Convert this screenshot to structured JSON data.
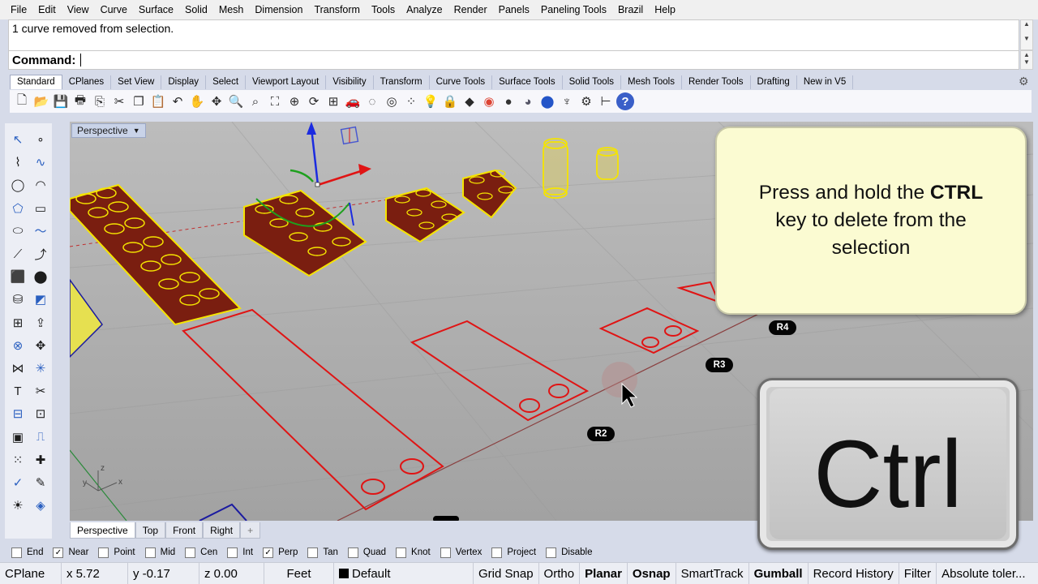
{
  "menu": [
    "File",
    "Edit",
    "View",
    "Curve",
    "Surface",
    "Solid",
    "Mesh",
    "Dimension",
    "Transform",
    "Tools",
    "Analyze",
    "Render",
    "Panels",
    "Paneling Tools",
    "Brazil",
    "Help"
  ],
  "history_text": "1 curve removed from selection.",
  "command_label": "Command:",
  "tabs": [
    "Standard",
    "CPlanes",
    "Set View",
    "Display",
    "Select",
    "Viewport Layout",
    "Visibility",
    "Transform",
    "Curve Tools",
    "Surface Tools",
    "Solid Tools",
    "Mesh Tools",
    "Render Tools",
    "Drafting",
    "New in V5"
  ],
  "toolbar_icons": [
    "new-file-icon",
    "open-file-icon",
    "save-icon",
    "print-icon",
    "import-icon",
    "cut-icon",
    "copy-icon",
    "paste-icon",
    "undo-icon",
    "pan-icon",
    "rotate-view-icon",
    "zoom-icon",
    "zoom-window-icon",
    "zoom-extents-icon",
    "zoom-selected-icon",
    "rotate-icon",
    "viewport-layout-icon",
    "car-icon",
    "hide-icon",
    "show-icon",
    "grips-icon",
    "light-bulb-icon",
    "lock-icon",
    "layer-icon",
    "color-wheel-icon",
    "render-sphere-icon",
    "render-preview-icon",
    "material-icon",
    "spotlight-icon",
    "options-icon",
    "dimension-icon",
    "help-icon"
  ],
  "left_tools": [
    "select-arrow-icon",
    "point-icon",
    "polyline-icon",
    "curve-icon",
    "circle-icon",
    "arc-icon",
    "polygon-icon",
    "rectangle-icon",
    "ellipse-icon",
    "freeform-icon",
    "curve-edit-icon",
    "fillet-icon",
    "box-icon",
    "sphere-icon",
    "cylinder-icon",
    "surface-icon",
    "mesh-icon",
    "extrude-icon",
    "boolean-icon",
    "transform-icon",
    "join-icon",
    "explode-icon",
    "text-icon",
    "trim-icon",
    "group-icon",
    "block-icon",
    "surface-box-icon",
    "analyze-icon",
    "array-icon",
    "move-icon",
    "check-icon",
    "paint-icon",
    "light-icon",
    "render-icon"
  ],
  "viewport": {
    "title": "Perspective"
  },
  "callout": {
    "line1_pre": "Press and hold the ",
    "line1_bold": "CTRL",
    "line2": "key to delete from the",
    "line3": "selection"
  },
  "badges": [
    "R4",
    "R3",
    "R2"
  ],
  "ctrl_key": "Ctrl",
  "view_tabs": [
    "Perspective",
    "Top",
    "Front",
    "Right"
  ],
  "add_view": "+",
  "osnaps": [
    {
      "label": "End",
      "checked": false
    },
    {
      "label": "Near",
      "checked": true
    },
    {
      "label": "Point",
      "checked": false
    },
    {
      "label": "Mid",
      "checked": false
    },
    {
      "label": "Cen",
      "checked": false
    },
    {
      "label": "Int",
      "checked": false
    },
    {
      "label": "Perp",
      "checked": true
    },
    {
      "label": "Tan",
      "checked": false
    },
    {
      "label": "Quad",
      "checked": false
    },
    {
      "label": "Knot",
      "checked": false
    },
    {
      "label": "Vertex",
      "checked": false
    },
    {
      "label": "Project",
      "checked": false
    },
    {
      "label": "Disable",
      "checked": false
    }
  ],
  "status": {
    "cplane": "CPlane",
    "x": "x 5.72",
    "y": "y -0.17",
    "z": "z 0.00",
    "units": "Feet",
    "layer": "Default",
    "grid_snap": "Grid Snap",
    "ortho": "Ortho",
    "planar": "Planar",
    "osnap": "Osnap",
    "smarttrack": "SmartTrack",
    "gumball": "Gumball",
    "record_history": "Record History",
    "filter": "Filter",
    "tolerance": "Absolute toler..."
  },
  "colors": {
    "viewport_bg": "#a7a7a7",
    "selection_yellow": "#f5e400",
    "curve_red": "#e01414",
    "callout_bg": "#fbfbd2"
  }
}
